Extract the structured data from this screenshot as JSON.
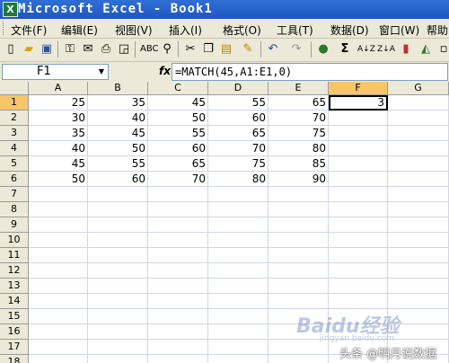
{
  "window": {
    "title": "Microsoft Excel - Book1"
  },
  "menu": [
    {
      "label": "文件(F)"
    },
    {
      "label": "编辑(E)"
    },
    {
      "label": "视图(V)"
    },
    {
      "label": "插入(I)"
    },
    {
      "label": "格式(O)"
    },
    {
      "label": "工具(T)"
    },
    {
      "label": "数据(D)"
    },
    {
      "label": "窗口(W)"
    },
    {
      "label": "帮助(H)"
    }
  ],
  "formula_bar": {
    "name_box": "F1",
    "fx": "fx",
    "formula": "=MATCH(45,A1:E1,0)"
  },
  "columns": [
    "A",
    "B",
    "C",
    "D",
    "E",
    "F",
    "G"
  ],
  "rows": [
    {
      "n": "1",
      "cells": [
        "25",
        "35",
        "45",
        "55",
        "65",
        "3",
        ""
      ]
    },
    {
      "n": "2",
      "cells": [
        "30",
        "40",
        "50",
        "60",
        "70",
        "",
        ""
      ]
    },
    {
      "n": "3",
      "cells": [
        "35",
        "45",
        "55",
        "65",
        "75",
        "",
        ""
      ]
    },
    {
      "n": "4",
      "cells": [
        "40",
        "50",
        "60",
        "70",
        "80",
        "",
        ""
      ]
    },
    {
      "n": "5",
      "cells": [
        "45",
        "55",
        "65",
        "75",
        "85",
        "",
        ""
      ]
    },
    {
      "n": "6",
      "cells": [
        "50",
        "60",
        "70",
        "80",
        "90",
        "",
        ""
      ]
    },
    {
      "n": "7",
      "cells": [
        "",
        "",
        "",
        "",
        "",
        "",
        ""
      ]
    },
    {
      "n": "8",
      "cells": [
        "",
        "",
        "",
        "",
        "",
        "",
        ""
      ]
    },
    {
      "n": "9",
      "cells": [
        "",
        "",
        "",
        "",
        "",
        "",
        ""
      ]
    },
    {
      "n": "10",
      "cells": [
        "",
        "",
        "",
        "",
        "",
        "",
        ""
      ]
    },
    {
      "n": "11",
      "cells": [
        "",
        "",
        "",
        "",
        "",
        "",
        ""
      ]
    },
    {
      "n": "12",
      "cells": [
        "",
        "",
        "",
        "",
        "",
        "",
        ""
      ]
    },
    {
      "n": "13",
      "cells": [
        "",
        "",
        "",
        "",
        "",
        "",
        ""
      ]
    },
    {
      "n": "14",
      "cells": [
        "",
        "",
        "",
        "",
        "",
        "",
        ""
      ]
    },
    {
      "n": "15",
      "cells": [
        "",
        "",
        "",
        "",
        "",
        "",
        ""
      ]
    },
    {
      "n": "16",
      "cells": [
        "",
        "",
        "",
        "",
        "",
        "",
        ""
      ]
    },
    {
      "n": "17",
      "cells": [
        "",
        "",
        "",
        "",
        "",
        "",
        ""
      ]
    },
    {
      "n": "18",
      "cells": [
        "",
        "",
        "",
        "",
        "",
        "",
        ""
      ]
    }
  ],
  "active_cell": {
    "col": "F",
    "row": "1"
  },
  "watermark": {
    "text": "Baidu经验",
    "sub": "jingyan.baidu.com"
  },
  "attribution": "头条 @明月说数据",
  "colors": {
    "selection_header": "#f7c66b",
    "title_bar": "#1f56c0"
  }
}
